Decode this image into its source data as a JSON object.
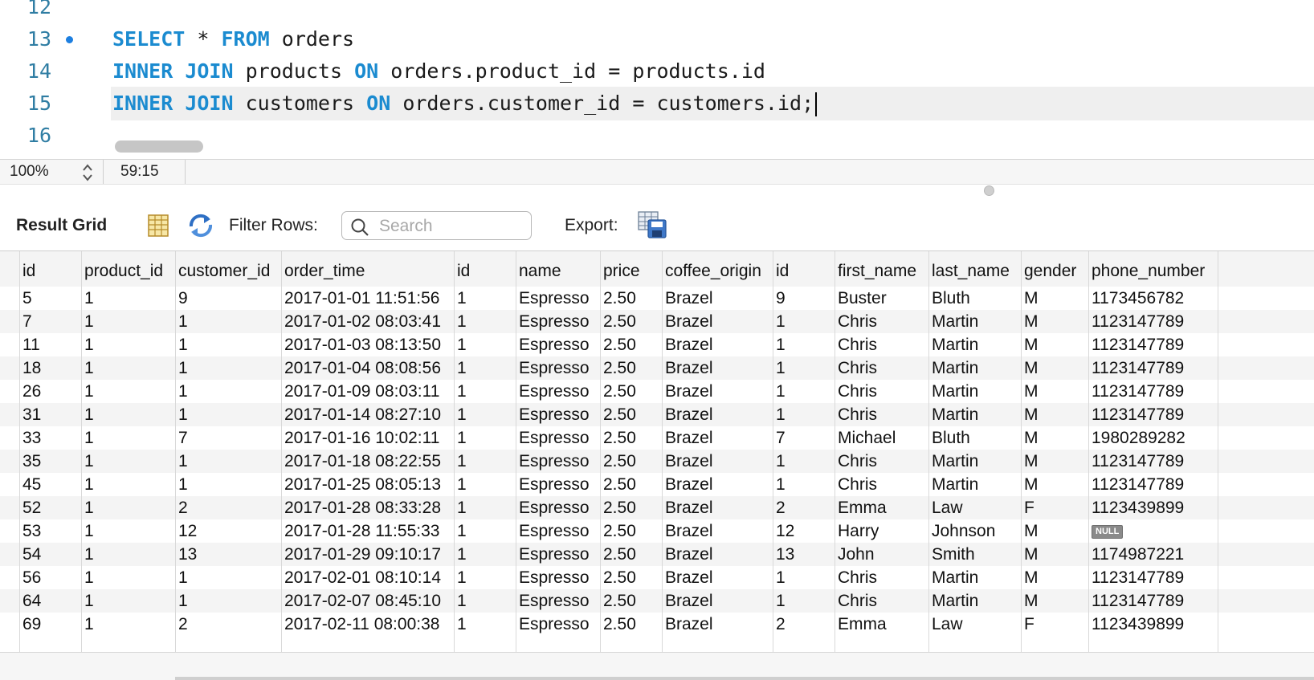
{
  "editor": {
    "lines": [
      {
        "num": "12",
        "text": ""
      },
      {
        "num": "13",
        "text": "SELECT * FROM orders"
      },
      {
        "num": "14",
        "text": "INNER JOIN products ON orders.product_id = products.id"
      },
      {
        "num": "15",
        "text": "INNER JOIN customers ON orders.customer_id = customers.id;"
      },
      {
        "num": "16",
        "text": ""
      }
    ],
    "keywords": [
      "SELECT",
      "FROM",
      "INNER",
      "JOIN",
      "ON"
    ]
  },
  "status": {
    "zoom": "100%",
    "cursor_position": "59:15"
  },
  "toolbar": {
    "title": "Result Grid",
    "filter_label": "Filter Rows:",
    "search_placeholder": "Search",
    "export_label": "Export:",
    "icons": [
      "grid-layout-icon",
      "refresh-icon",
      "search-icon",
      "export-icon"
    ]
  },
  "grid": {
    "columns": [
      "id",
      "product_id",
      "customer_id",
      "order_time",
      "id",
      "name",
      "price",
      "coffee_origin",
      "id",
      "first_name",
      "last_name",
      "gender",
      "phone_number"
    ],
    "rows": [
      [
        "5",
        "1",
        "9",
        "2017-01-01 11:51:56",
        "1",
        "Espresso",
        "2.50",
        "Brazel",
        "9",
        "Buster",
        "Bluth",
        "M",
        "1173456782"
      ],
      [
        "7",
        "1",
        "1",
        "2017-01-02 08:03:41",
        "1",
        "Espresso",
        "2.50",
        "Brazel",
        "1",
        "Chris",
        "Martin",
        "M",
        "1123147789"
      ],
      [
        "11",
        "1",
        "1",
        "2017-01-03 08:13:50",
        "1",
        "Espresso",
        "2.50",
        "Brazel",
        "1",
        "Chris",
        "Martin",
        "M",
        "1123147789"
      ],
      [
        "18",
        "1",
        "1",
        "2017-01-04 08:08:56",
        "1",
        "Espresso",
        "2.50",
        "Brazel",
        "1",
        "Chris",
        "Martin",
        "M",
        "1123147789"
      ],
      [
        "26",
        "1",
        "1",
        "2017-01-09 08:03:11",
        "1",
        "Espresso",
        "2.50",
        "Brazel",
        "1",
        "Chris",
        "Martin",
        "M",
        "1123147789"
      ],
      [
        "31",
        "1",
        "1",
        "2017-01-14 08:27:10",
        "1",
        "Espresso",
        "2.50",
        "Brazel",
        "1",
        "Chris",
        "Martin",
        "M",
        "1123147789"
      ],
      [
        "33",
        "1",
        "7",
        "2017-01-16 10:02:11",
        "1",
        "Espresso",
        "2.50",
        "Brazel",
        "7",
        "Michael",
        "Bluth",
        "M",
        "1980289282"
      ],
      [
        "35",
        "1",
        "1",
        "2017-01-18 08:22:55",
        "1",
        "Espresso",
        "2.50",
        "Brazel",
        "1",
        "Chris",
        "Martin",
        "M",
        "1123147789"
      ],
      [
        "45",
        "1",
        "1",
        "2017-01-25 08:05:13",
        "1",
        "Espresso",
        "2.50",
        "Brazel",
        "1",
        "Chris",
        "Martin",
        "M",
        "1123147789"
      ],
      [
        "52",
        "1",
        "2",
        "2017-01-28 08:33:28",
        "1",
        "Espresso",
        "2.50",
        "Brazel",
        "2",
        "Emma",
        "Law",
        "F",
        "1123439899"
      ],
      [
        "53",
        "1",
        "12",
        "2017-01-28 11:55:33",
        "1",
        "Espresso",
        "2.50",
        "Brazel",
        "12",
        "Harry",
        "Johnson",
        "M",
        "NULL"
      ],
      [
        "54",
        "1",
        "13",
        "2017-01-29 09:10:17",
        "1",
        "Espresso",
        "2.50",
        "Brazel",
        "13",
        "John",
        "Smith",
        "M",
        "1174987221"
      ],
      [
        "56",
        "1",
        "1",
        "2017-02-01 08:10:14",
        "1",
        "Espresso",
        "2.50",
        "Brazel",
        "1",
        "Chris",
        "Martin",
        "M",
        "1123147789"
      ],
      [
        "64",
        "1",
        "1",
        "2017-02-07 08:45:10",
        "1",
        "Espresso",
        "2.50",
        "Brazel",
        "1",
        "Chris",
        "Martin",
        "M",
        "1123147789"
      ],
      [
        "69",
        "1",
        "2",
        "2017-02-11 08:00:38",
        "1",
        "Espresso",
        "2.50",
        "Brazel",
        "2",
        "Emma",
        "Law",
        "F",
        "1123439899"
      ]
    ],
    "null_label": "NULL"
  },
  "colors": {
    "keyword": "#1b8bd0",
    "line_number": "#2f7da3",
    "breakpoint": "#1d7fe0",
    "current_line": "#efefef",
    "row_alt": "#f4f4f4"
  }
}
